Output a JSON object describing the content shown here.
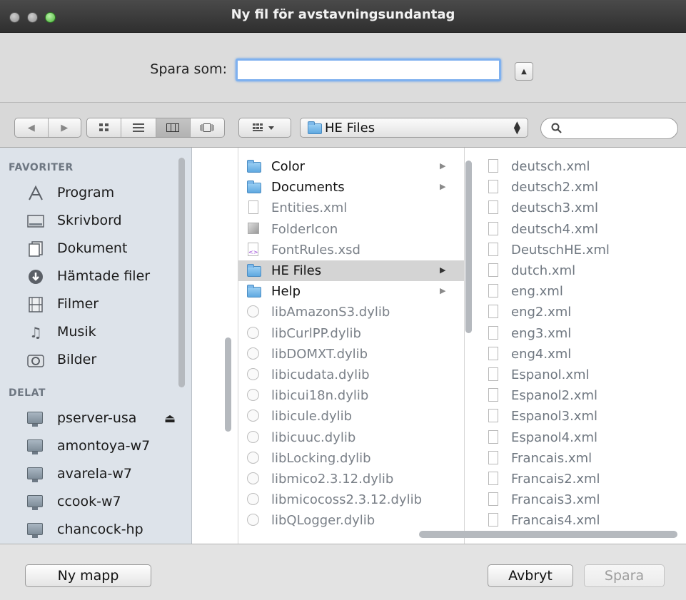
{
  "window": {
    "title": "Ny fil för avstavningsundantag"
  },
  "save": {
    "label": "Spara som:",
    "value": "",
    "expand_icon": "triangle-up-icon"
  },
  "toolbar": {
    "view_modes": [
      "icon-view",
      "list-view",
      "column-view",
      "coverflow-view"
    ],
    "active_view": "column-view",
    "path_popup": "HE Files",
    "search_value": ""
  },
  "sidebar": {
    "favorites_header": "FAVORITER",
    "favorites": [
      {
        "label": "Program",
        "icon": "applications-icon"
      },
      {
        "label": "Skrivbord",
        "icon": "desktop-icon"
      },
      {
        "label": "Dokument",
        "icon": "documents-icon"
      },
      {
        "label": "Hämtade filer",
        "icon": "downloads-icon"
      },
      {
        "label": "Filmer",
        "icon": "movies-icon"
      },
      {
        "label": "Musik",
        "icon": "music-icon"
      },
      {
        "label": "Bilder",
        "icon": "pictures-icon"
      }
    ],
    "shared_header": "DELAT",
    "shared": [
      {
        "label": "pserver-usa",
        "eject": true
      },
      {
        "label": "amontoya-w7"
      },
      {
        "label": "avarela-w7"
      },
      {
        "label": "ccook-w7"
      },
      {
        "label": "chancock-hp"
      }
    ]
  },
  "column1": [
    {
      "label": "Color",
      "kind": "folder",
      "arrow": true
    },
    {
      "label": "Documents",
      "kind": "folder",
      "arrow": true
    },
    {
      "label": "Entities.xml",
      "kind": "doc"
    },
    {
      "label": "FolderIcon",
      "kind": "image"
    },
    {
      "label": "FontRules.xsd",
      "kind": "xsd"
    },
    {
      "label": "HE Files",
      "kind": "folder",
      "arrow": true,
      "selected": true
    },
    {
      "label": "Help",
      "kind": "folder",
      "arrow": true
    },
    {
      "label": "libAmazonS3.dylib",
      "kind": "lib"
    },
    {
      "label": "libCurlPP.dylib",
      "kind": "lib"
    },
    {
      "label": "libDOMXT.dylib",
      "kind": "lib"
    },
    {
      "label": "libicudata.dylib",
      "kind": "lib"
    },
    {
      "label": "libicui18n.dylib",
      "kind": "lib"
    },
    {
      "label": "libicule.dylib",
      "kind": "lib"
    },
    {
      "label": "libicuuc.dylib",
      "kind": "lib"
    },
    {
      "label": "libLocking.dylib",
      "kind": "lib"
    },
    {
      "label": "libmico2.3.12.dylib",
      "kind": "lib"
    },
    {
      "label": "libmicocoss2.3.12.dylib",
      "kind": "lib"
    },
    {
      "label": "libQLogger.dylib",
      "kind": "lib"
    }
  ],
  "column2": [
    "deutsch.xml",
    "deutsch2.xml",
    "deutsch3.xml",
    "deutsch4.xml",
    "DeutschHE.xml",
    "dutch.xml",
    "eng.xml",
    "eng2.xml",
    "eng3.xml",
    "eng4.xml",
    "Espanol.xml",
    "Espanol2.xml",
    "Espanol3.xml",
    "Espanol4.xml",
    "Francais.xml",
    "Francais2.xml",
    "Francais3.xml",
    "Francais4.xml"
  ],
  "buttons": {
    "new_folder": "Ny mapp",
    "cancel": "Avbryt",
    "save": "Spara"
  }
}
